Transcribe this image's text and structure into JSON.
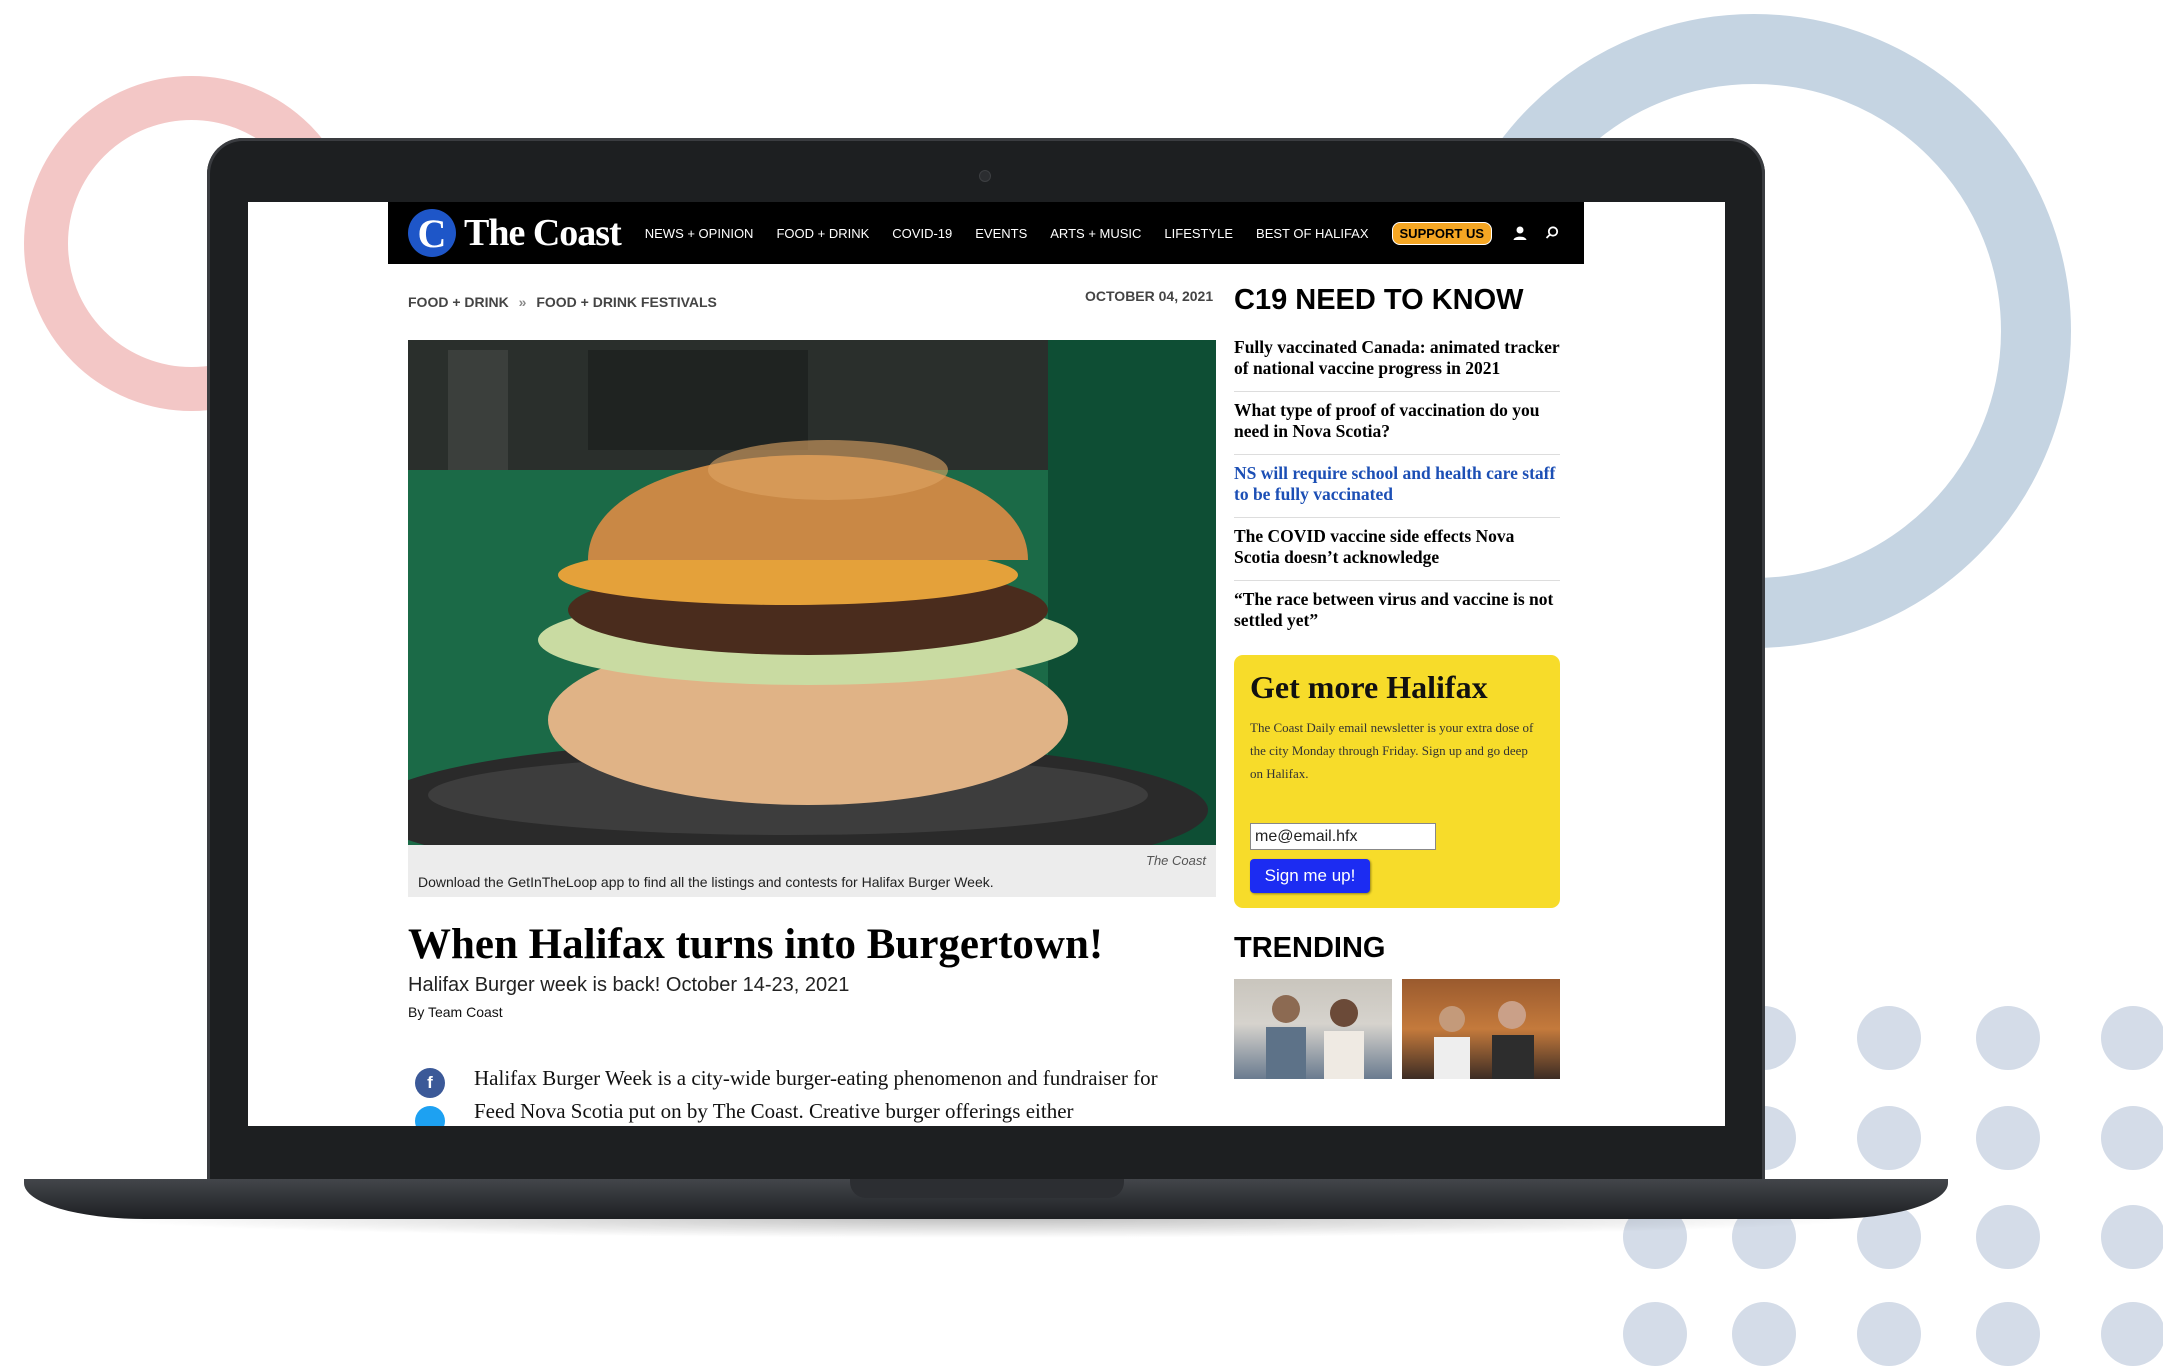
{
  "navbar": {
    "logo_mark": "C",
    "logo_text": "The Coast",
    "items": [
      "NEWS + OPINION",
      "FOOD + DRINK",
      "COVID-19",
      "EVENTS",
      "ARTS + MUSIC",
      "LIFESTYLE",
      "BEST OF HALIFAX"
    ],
    "support_label": "SUPPORT US"
  },
  "breadcrumb": {
    "level1": "FOOD + DRINK",
    "separator": "»",
    "level2": "FOOD + DRINK FESTIVALS"
  },
  "article": {
    "date": "OCTOBER 04, 2021",
    "image_credit": "The Coast",
    "image_caption": "Download the GetInTheLoop app to find all the listings and contests for Halifax Burger Week.",
    "headline": "When Halifax turns into Burgertown!",
    "subheadline": "Halifax Burger week is back! October 14-23, 2021",
    "byline": "By Team Coast",
    "body": "Halifax Burger Week is a city-wide burger-eating phenomenon and fundraiser for Feed Nova Scotia put on by The Coast. Creative burger offerings either"
  },
  "sidebar": {
    "c19_title": "C19 NEED TO KNOW",
    "c19_links": [
      "Fully vaccinated Canada: animated tracker of national vaccine progress in 2021",
      "What type of proof of vaccination do you need in Nova Scotia?",
      "NS will require school and health care staff to be fully vaccinated",
      "The COVID vaccine side effects Nova Scotia doesn’t acknowledge",
      "“The race between virus and vaccine is not settled yet”"
    ],
    "newsletter": {
      "title": "Get more Halifax",
      "description": "The Coast Daily email newsletter is your extra dose of the city Monday through Friday. Sign up and go deep on Halifax.",
      "email_value": "me@email.hfx",
      "button_label": "Sign me up!"
    },
    "trending_title": "TRENDING"
  },
  "colors": {
    "brand_blue": "#1e56c8",
    "support_orange": "#f5a623",
    "newsletter_yellow": "#f7dc2a",
    "signup_blue": "#1c2cf2",
    "link_blue": "#1c4fb5"
  },
  "icons": [
    "user-icon",
    "search-icon",
    "facebook-icon",
    "twitter-icon"
  ]
}
